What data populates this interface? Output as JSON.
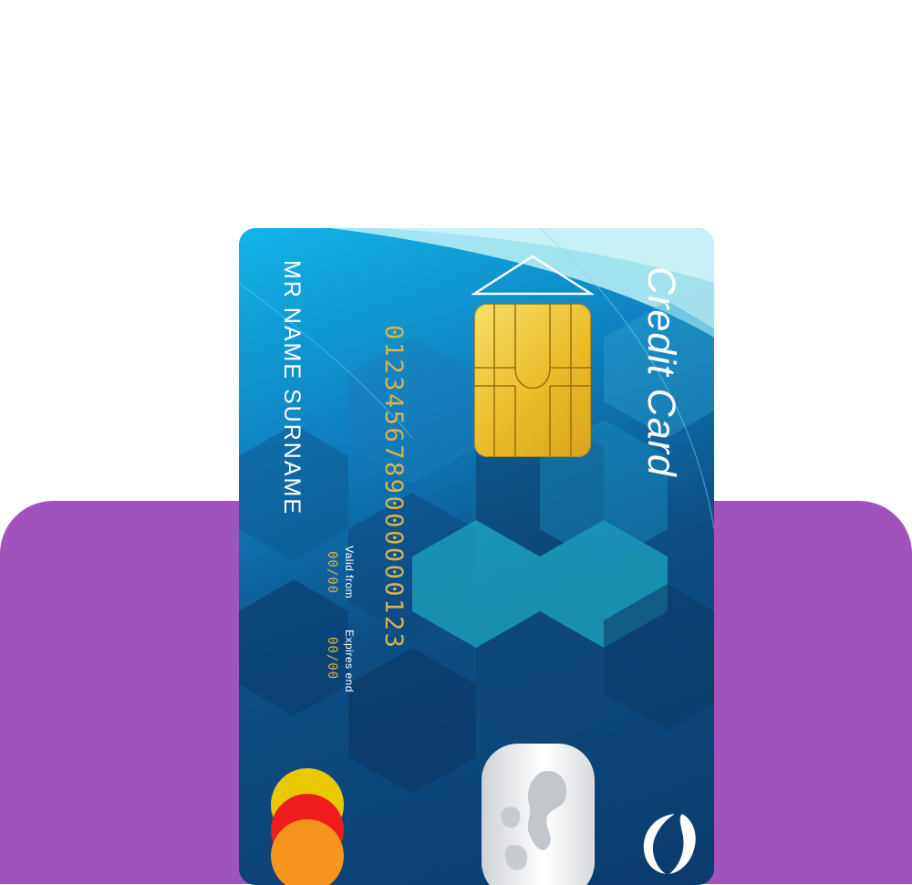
{
  "card": {
    "brand_label": "Credit Card",
    "holder_name": "MR  NAME  SURNAME",
    "number": "0123456789000000123",
    "valid_from_label": "Valid  from",
    "valid_from_date": "00/00",
    "expires_label": "Expires  end",
    "expires_date": "00/00"
  },
  "colors": {
    "background": "#ffffff",
    "panel": "#a153bd",
    "card_light": "#12b5e8",
    "card_dark": "#0c3a6b",
    "chip": "#f0c93a",
    "number": "#d8b24a"
  },
  "icons": [
    "chip-icon",
    "arrow-icon",
    "globe-hologram-icon",
    "card-network-logo",
    "crescent-icon"
  ]
}
